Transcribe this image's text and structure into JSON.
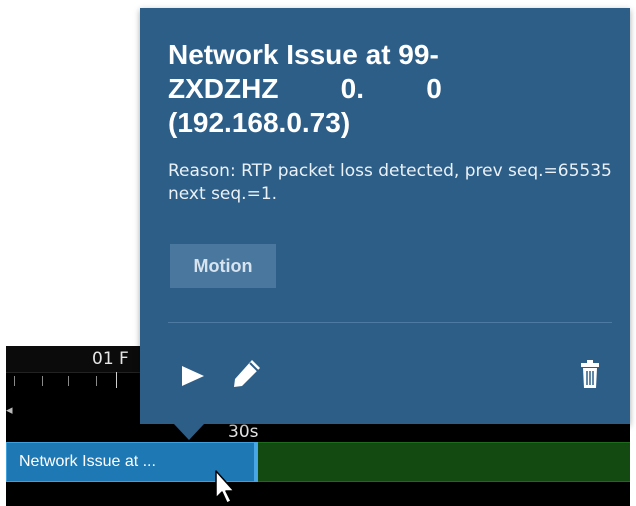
{
  "timeline": {
    "date_label": "01 F",
    "time_label": "30s",
    "side_marker": "◂",
    "event_label": "Network Issue at ..."
  },
  "popover": {
    "title_lines": [
      "Network Issue at 99-",
      "ZXDZHZ        0.        0",
      "(192.168.0.73)"
    ],
    "reason": "Reason: RTP packet loss detected, prev seq.=65535 next seq.=1.",
    "tag": "Motion"
  },
  "icons": {
    "play": "play-icon",
    "edit": "pencil-icon",
    "delete": "trash-icon"
  },
  "colors": {
    "popover_bg": "#2d5e88",
    "event_blue": "#1e78b4",
    "motion_green": "#124a12",
    "tag_bg": "#4a779e"
  }
}
